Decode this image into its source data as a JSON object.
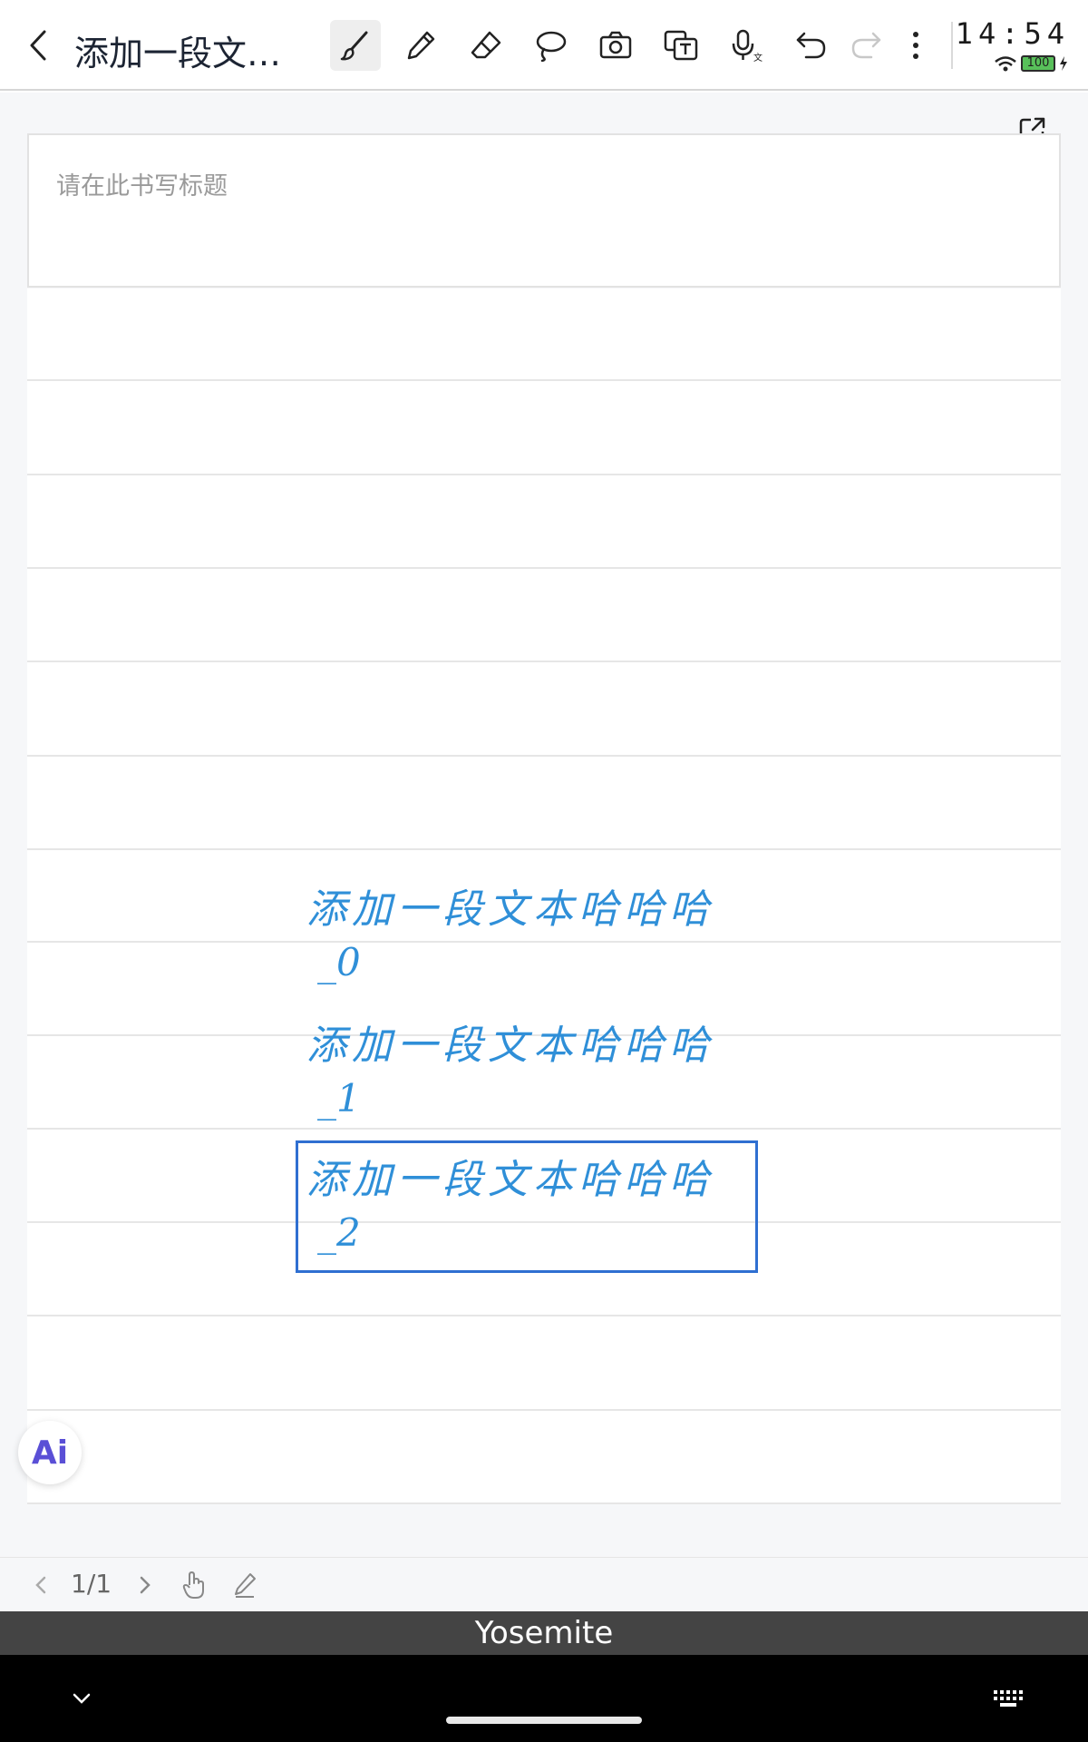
{
  "toolbar": {
    "title": "添加一段文本...",
    "tools": [
      {
        "name": "brush-icon",
        "active": true
      },
      {
        "name": "pen-icon",
        "active": false
      },
      {
        "name": "eraser-icon",
        "active": false
      },
      {
        "name": "lasso-icon",
        "active": false
      },
      {
        "name": "camera-icon",
        "active": false
      },
      {
        "name": "text-recognition-icon",
        "active": false
      },
      {
        "name": "voice-to-text-icon",
        "active": false
      },
      {
        "name": "undo-icon",
        "active": false
      },
      {
        "name": "redo-icon",
        "active": false,
        "disabled": true
      },
      {
        "name": "more-icon",
        "active": false
      }
    ]
  },
  "status": {
    "time": "14:54",
    "battery": "100"
  },
  "title_box": {
    "placeholder": "请在此书写标题"
  },
  "handwriting": [
    {
      "text": "添加一段文本哈哈哈",
      "suffix": "_0"
    },
    {
      "text": "添加一段文本哈哈哈",
      "suffix": "_1"
    },
    {
      "text": "添加一段文本哈哈哈",
      "suffix": "_2"
    }
  ],
  "ai_button": {
    "label": "Ai"
  },
  "pagebar": {
    "page_indicator": "1/1"
  },
  "keyboard": {
    "suggestion": "Yosemite"
  },
  "colors": {
    "ink": "#2f8fd8",
    "selection": "#2f6fd1",
    "ai": "#5a4fd6"
  }
}
